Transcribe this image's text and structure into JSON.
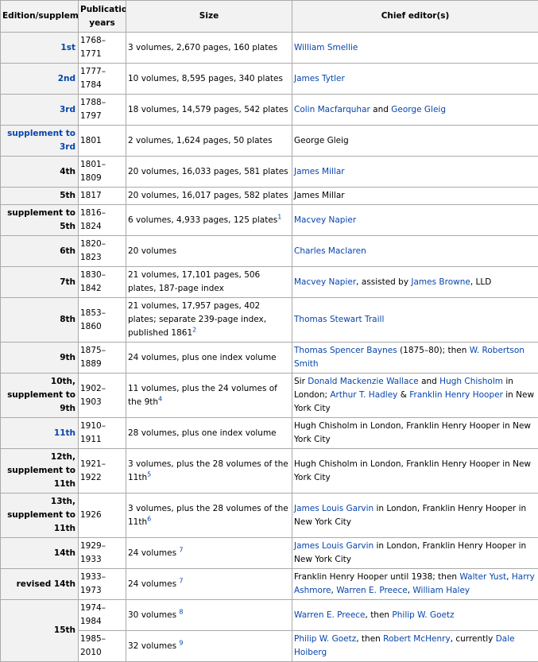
{
  "headers": {
    "edition": "Edition/supplement",
    "years_line1": "Publication",
    "years_line2": "years",
    "size": "Size",
    "editor": "Chief editor(s)"
  },
  "rows": [
    {
      "edition": "1st",
      "years": "1768–1771",
      "size": "3 volumes, 2,670 pages, 160 plates",
      "editor": [
        "William Smellie"
      ]
    },
    {
      "edition": "2nd",
      "years": "1777–1784",
      "size": "10 volumes, 8,595 pages, 340 plates",
      "editor": [
        "James Tytler"
      ]
    },
    {
      "edition": "3rd",
      "years": "1788–1797",
      "size": "18 volumes, 14,579 pages, 542 plates",
      "editor": [
        "Colin Macfarquhar",
        " and ",
        "George Gleig"
      ]
    },
    {
      "edition": "supplement to 3rd",
      "years": "1801",
      "size": "2 volumes, 1,624 pages, 50 plates",
      "editor": [
        "George Gleig"
      ]
    },
    {
      "edition": "4th",
      "years": "1801–1809",
      "size": "20 volumes, 16,033 pages, 581 plates",
      "editor": [
        "James Millar"
      ]
    },
    {
      "edition": "5th",
      "years": "1817",
      "size": "20 volumes, 16,017 pages, 582 plates",
      "editor": [
        "James Millar"
      ]
    },
    {
      "edition": "supplement to 5th",
      "years": "1816–1824",
      "size": "6 volumes, 4,933 pages, 125 plates",
      "size_sup": "1",
      "editor": [
        "Macvey Napier"
      ]
    },
    {
      "edition": "6th",
      "years": "1820–1823",
      "size": "20 volumes",
      "editor": [
        "Charles Maclaren"
      ]
    },
    {
      "edition": "7th",
      "years": "1830–1842",
      "size": "21 volumes, 17,101 pages, 506 plates, 187-page index",
      "editor": [
        "Macvey Napier",
        ", assisted by ",
        "James Browne",
        ", LLD"
      ]
    },
    {
      "edition": "8th",
      "years": "1853–1860",
      "size": "21 volumes, 17,957 pages, 402 plates; separate 239-page index, published 1861",
      "size_sup": "2",
      "editor": [
        "Thomas Stewart Traill"
      ]
    },
    {
      "edition": "9th",
      "years": "1875–1889",
      "size": "24 volumes, plus one index volume",
      "editor": [
        "Thomas Spencer Baynes",
        " (1875–80); then ",
        "W. Robertson Smith"
      ]
    },
    {
      "edition_line1": "10th,",
      "edition_line2": "supplement to 9th",
      "years": "1902–1903",
      "size": "11 volumes, plus the 24 volumes of the 9th",
      "size_sup": "4",
      "editor": [
        "Sir ",
        "Donald Mackenzie Wallace",
        " and ",
        "Hugh Chisholm",
        " in London; ",
        "Arthur T. Hadley",
        " & ",
        "Franklin Henry Hooper",
        " in New York City"
      ]
    },
    {
      "edition": "11th",
      "years": "1910–1911",
      "size": "28 volumes, plus one index volume",
      "editor": [
        "Hugh Chisholm in London, Franklin Henry Hooper in New York City"
      ]
    },
    {
      "edition_line1": "12th,",
      "edition_line2": "supplement to 11th",
      "years": "1921–1922",
      "size": "3 volumes, plus the 28 volumes of the 11th",
      "size_sup": "5",
      "editor": [
        "Hugh Chisholm in London, Franklin Henry Hooper in New York City"
      ]
    },
    {
      "edition_line1": "13th,",
      "edition_line2": "supplement to 11th",
      "years": "1926",
      "size": "3 volumes, plus the 28 volumes of the 11th",
      "size_sup": "6",
      "editor": [
        "James Louis Garvin",
        " in London, Franklin Henry Hooper in New York City"
      ]
    },
    {
      "edition": "14th",
      "years": "1929–1933",
      "size": "24 volumes ",
      "size_sup": "7",
      "editor": [
        "James Louis Garvin",
        " in London, Franklin Henry Hooper in New York City"
      ]
    },
    {
      "edition": "revised 14th",
      "years": "1933–1973",
      "size": "24 volumes ",
      "size_sup": "7",
      "editor": [
        "Franklin Henry Hooper until 1938; then ",
        "Walter Yust",
        ", ",
        "Harry Ashmore",
        ", ",
        "Warren E. Preece",
        ", ",
        "William Haley"
      ]
    },
    {
      "edition": "15th",
      "years": "1974–1984",
      "size": "30 volumes ",
      "size_sup": "8",
      "editor": [
        "Warren E. Preece",
        ", then ",
        "Philip W. Goetz"
      ]
    },
    {
      "years": "1985–2010",
      "size": "32 volumes ",
      "size_sup": "9",
      "editor": [
        "Philip W. Goetz",
        ", then ",
        "Robert McHenry",
        ", currently ",
        "Dale Hoiberg"
      ]
    }
  ]
}
